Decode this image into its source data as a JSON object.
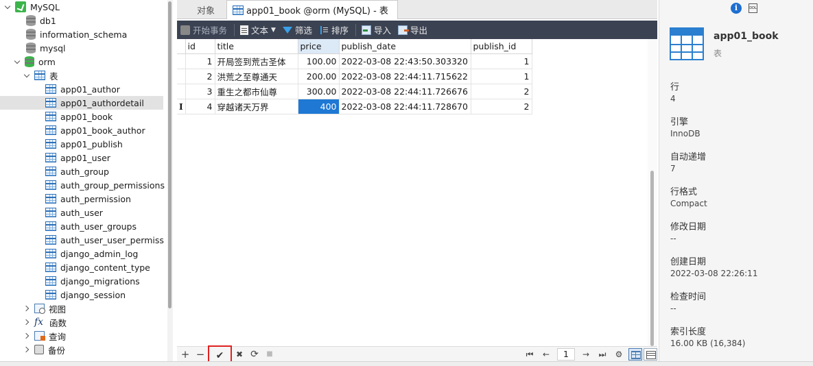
{
  "tree": {
    "connection": "MySQL",
    "databases": [
      "db1",
      "information_schema",
      "mysql"
    ],
    "active_db": "orm",
    "tables_group": "表",
    "tables": [
      "app01_author",
      "app01_authordetail",
      "app01_book",
      "app01_book_author",
      "app01_publish",
      "app01_user",
      "auth_group",
      "auth_group_permissions",
      "auth_permission",
      "auth_user",
      "auth_user_groups",
      "auth_user_user_permissior",
      "django_admin_log",
      "django_content_type",
      "django_migrations",
      "django_session"
    ],
    "selected_table": "app01_authordetail",
    "groups": [
      "视图",
      "函数",
      "查询",
      "备份"
    ]
  },
  "tabs": {
    "objects": "对象",
    "active": "app01_book @orm (MySQL) - 表"
  },
  "toolbar": {
    "begin": "开始事务",
    "text": "文本",
    "filter": "筛选",
    "sort": "排序",
    "import": "导入",
    "export": "导出"
  },
  "grid": {
    "columns": [
      "id",
      "title",
      "price",
      "publish_date",
      "publish_id"
    ],
    "rows": [
      [
        "1",
        "开局签到荒古圣体",
        "100.00",
        "2022-03-08 22:43:50.303320",
        "1"
      ],
      [
        "2",
        "洪荒之至尊通天",
        "200.00",
        "2022-03-08 22:44:11.715622",
        "1"
      ],
      [
        "3",
        "重生之都市仙尊",
        "300.00",
        "2022-03-08 22:44:11.726676",
        "2"
      ],
      [
        "4",
        "穿越诸天万界",
        "400",
        "2022-03-08 22:44:11.728670",
        "2"
      ]
    ],
    "editing_row_marker": "I"
  },
  "bottombar": {
    "add": "+",
    "remove": "−",
    "apply": "✔",
    "discard": "✖",
    "refresh": "⟳",
    "stop": "■",
    "page": "1"
  },
  "info": {
    "name": "app01_book",
    "type": "表",
    "props": [
      {
        "label": "行",
        "value": "4"
      },
      {
        "label": "引擎",
        "value": "InnoDB"
      },
      {
        "label": "自动递增",
        "value": "7"
      },
      {
        "label": "行格式",
        "value": "Compact"
      },
      {
        "label": "修改日期",
        "value": "--"
      },
      {
        "label": "创建日期",
        "value": "2022-03-08 22:26:11"
      },
      {
        "label": "检查时间",
        "value": "--"
      },
      {
        "label": "索引长度",
        "value": "16.00 KB (16,384)"
      }
    ],
    "ddl_label": "DDL"
  },
  "colors": {
    "toolbar": "#3b4252",
    "selection": "#1e78d4",
    "highlight_red": "#e02020"
  }
}
